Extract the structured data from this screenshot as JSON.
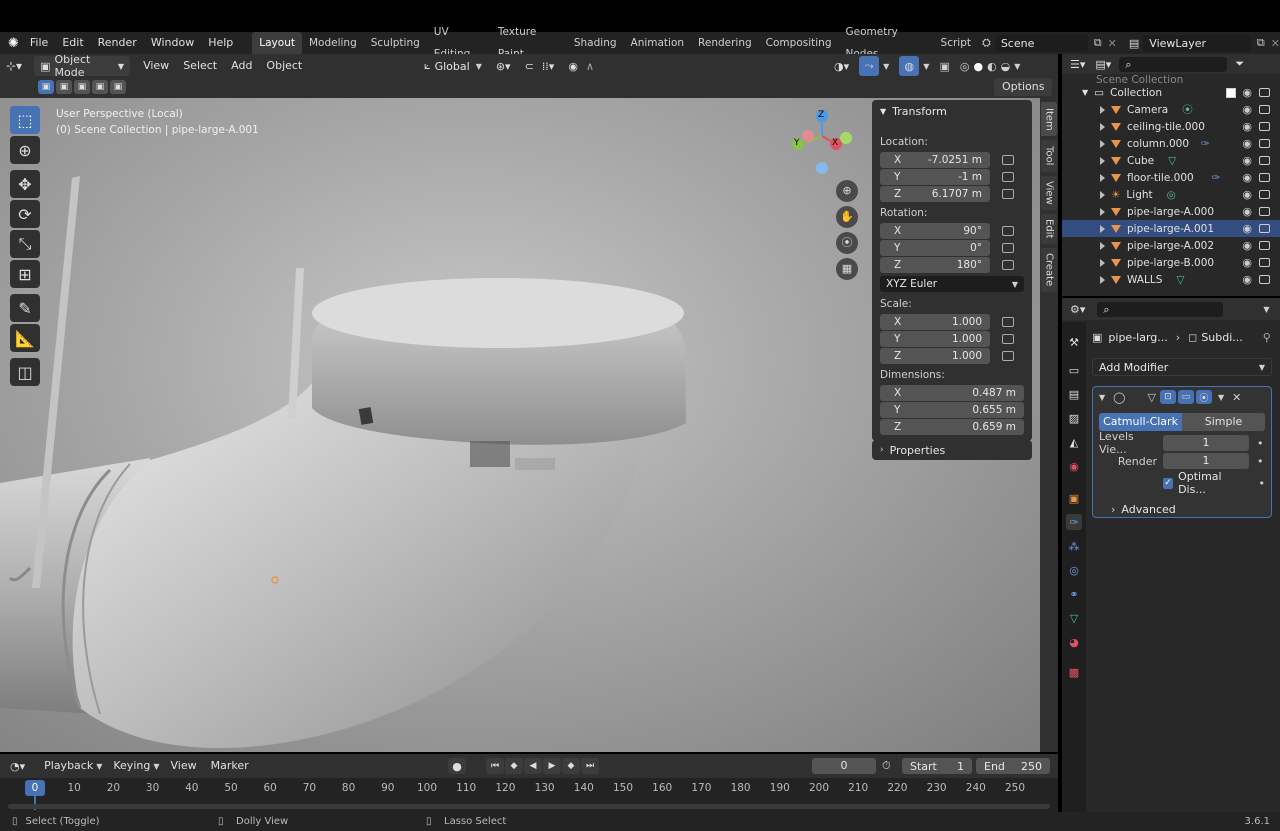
{
  "app": {
    "version": "3.6.1"
  },
  "topbar": {
    "menus": [
      "File",
      "Edit",
      "Render",
      "Window",
      "Help"
    ],
    "workspaces": [
      "Layout",
      "Modeling",
      "Sculpting",
      "UV Editing",
      "Texture Paint",
      "Shading",
      "Animation",
      "Rendering",
      "Compositing",
      "Geometry Nodes",
      "Script"
    ],
    "active_workspace": "Layout",
    "scene": "Scene",
    "view_layer": "ViewLayer"
  },
  "viewport_header": {
    "mode": "Object Mode",
    "menus": [
      "View",
      "Select",
      "Add",
      "Object"
    ],
    "transform_orientation": "Global",
    "options_label": "Options"
  },
  "viewport": {
    "info_line1": "User Perspective (Local)",
    "info_line2": "(0) Scene Collection | pipe-large-A.001",
    "gizmo": {
      "z": "Z",
      "y": "Y",
      "x": "X"
    }
  },
  "side_tabs": [
    "Item",
    "Tool",
    "View",
    "Edit",
    "Create"
  ],
  "npanel": {
    "transform_title": "Transform",
    "location_label": "Location:",
    "location": [
      {
        "axis": "X",
        "value": "-7.0251 m"
      },
      {
        "axis": "Y",
        "value": "-1 m"
      },
      {
        "axis": "Z",
        "value": "6.1707 m"
      }
    ],
    "rotation_label": "Rotation:",
    "rotation": [
      {
        "axis": "X",
        "value": "90°"
      },
      {
        "axis": "Y",
        "value": "0°"
      },
      {
        "axis": "Z",
        "value": "180°"
      }
    ],
    "rotation_mode": "XYZ Euler",
    "scale_label": "Scale:",
    "scale": [
      {
        "axis": "X",
        "value": "1.000"
      },
      {
        "axis": "Y",
        "value": "1.000"
      },
      {
        "axis": "Z",
        "value": "1.000"
      }
    ],
    "dimensions_label": "Dimensions:",
    "dimensions": [
      {
        "axis": "X",
        "value": "0.487 m"
      },
      {
        "axis": "Y",
        "value": "0.655 m"
      },
      {
        "axis": "Z",
        "value": "0.659 m"
      }
    ],
    "properties_title": "Properties"
  },
  "outliner": {
    "header_partial": "Scene Collection",
    "collection": "Collection",
    "items": [
      "Camera",
      "ceiling-tile.000",
      "column.000",
      "Cube",
      "floor-tile.000",
      "Light",
      "pipe-large-A.000",
      "pipe-large-A.001",
      "pipe-large-A.002",
      "pipe-large-B.000",
      "WALLS"
    ]
  },
  "properties": {
    "breadcrumb_object": "pipe-larg...",
    "breadcrumb_modifier": "Subdi...",
    "add_modifier": "Add Modifier",
    "subdiv_types": [
      "Catmull-Clark",
      "Simple"
    ],
    "active_type": "Catmull-Clark",
    "levels_label": "Levels Vie...",
    "levels_value": "1",
    "render_label": "Render",
    "render_value": "1",
    "optimal_label": "Optimal Dis...",
    "advanced_label": "Advanced"
  },
  "timeline": {
    "menus": [
      "Playback",
      "Keying",
      "View",
      "Marker"
    ],
    "current_frame": "0",
    "start_label": "Start",
    "start_value": "1",
    "end_label": "End",
    "end_value": "250",
    "ticks": [
      "0",
      "10",
      "20",
      "30",
      "40",
      "50",
      "60",
      "70",
      "80",
      "90",
      "100",
      "110",
      "120",
      "130",
      "140",
      "150",
      "160",
      "170",
      "180",
      "190",
      "200",
      "210",
      "220",
      "230",
      "240",
      "250"
    ]
  },
  "status": {
    "select": "Select (Toggle)",
    "dolly": "Dolly View",
    "lasso": "Lasso Select"
  },
  "colors": {
    "accent": "#4772b3",
    "object_orange": "#e8954a",
    "x_axis": "#e0525f",
    "y_axis": "#8bc34a",
    "z_axis": "#4a9be8"
  }
}
